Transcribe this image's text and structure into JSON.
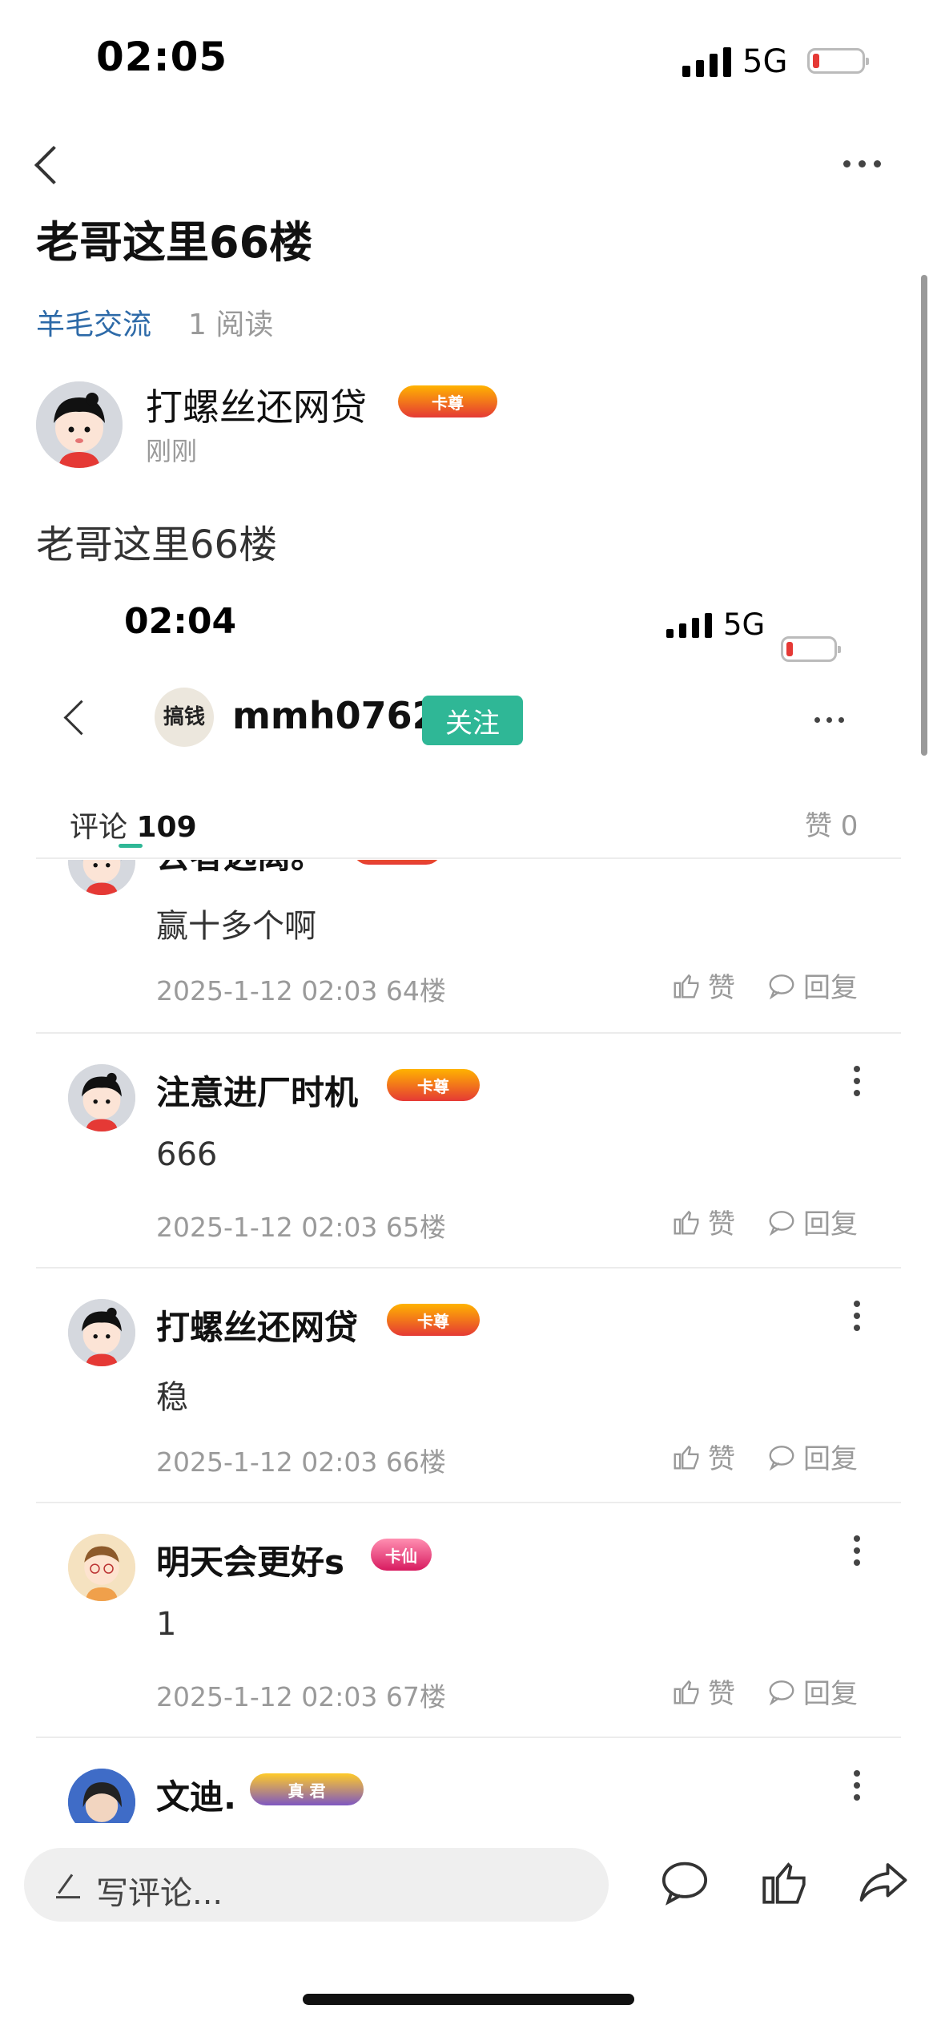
{
  "status_bar": {
    "time": "02:05",
    "network": "5G"
  },
  "post": {
    "title": "老哥这里66楼",
    "category": "羊毛交流",
    "reads": "1 阅读",
    "author": "打螺丝还网贷",
    "author_badge": "卡尊",
    "time": "刚刚",
    "content": "老哥这里66楼"
  },
  "embedded": {
    "status_time": "02:04",
    "network": "5G",
    "avatar_text": "搞钱",
    "username": "mmh0762",
    "follow_label": "关注",
    "tab_comments_label": "评论",
    "tab_comments_count": "109",
    "tab_likes": "赞 0",
    "comments": [
      {
        "name": "去者远离。",
        "badge": "卡尊",
        "text": "赢十多个啊",
        "meta": "2025-1-12 02:03  64楼",
        "like": "赞",
        "reply": "回复"
      },
      {
        "name": "注意进厂时机",
        "badge": "卡尊",
        "text": "666",
        "meta": "2025-1-12 02:03  65楼",
        "like": "赞",
        "reply": "回复"
      },
      {
        "name": "打螺丝还网贷",
        "badge": "卡尊",
        "text": "稳",
        "meta": "2025-1-12 02:03  66楼",
        "like": "赞",
        "reply": "回复"
      },
      {
        "name": "明天会更好s",
        "badge": "卡仙",
        "text": "1",
        "meta": "2025-1-12 02:03  67楼",
        "like": "赞",
        "reply": "回复"
      },
      {
        "name": "文迪.",
        "badge": "真 君",
        "text": "",
        "meta": "",
        "like": "",
        "reply": ""
      }
    ]
  },
  "bottom_bar": {
    "comment_placeholder": "写评论..."
  },
  "colors": {
    "accent_green": "#2fb796",
    "link_blue": "#2d6aa8",
    "battery_low": "#e53935"
  }
}
